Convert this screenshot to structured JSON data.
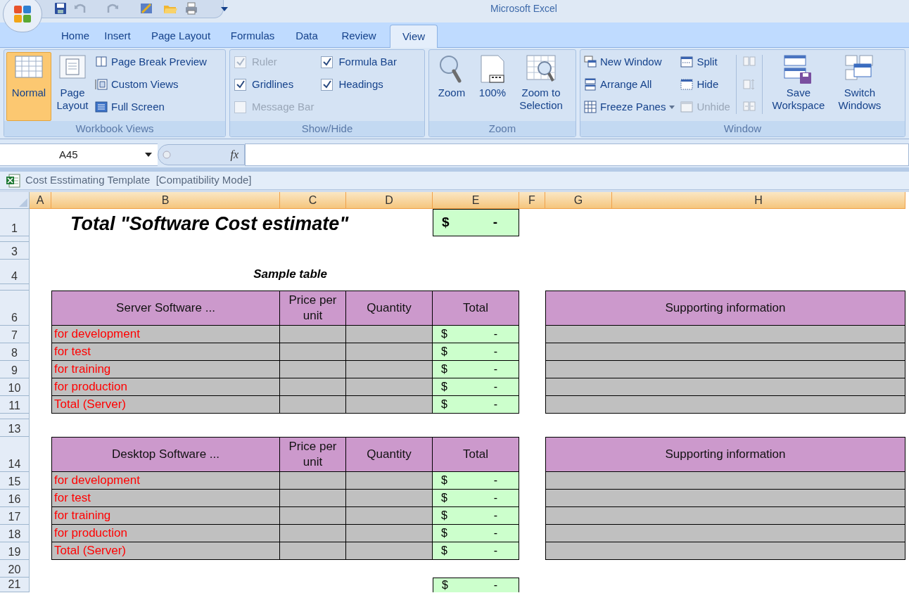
{
  "window": {
    "title": "Microsoft Excel"
  },
  "ribbon_tabs": [
    {
      "label": "Home",
      "selected": false
    },
    {
      "label": "Insert",
      "selected": false
    },
    {
      "label": "Page Layout",
      "selected": false
    },
    {
      "label": "Formulas",
      "selected": false
    },
    {
      "label": "Data",
      "selected": false
    },
    {
      "label": "Review",
      "selected": false
    },
    {
      "label": "View",
      "selected": true
    }
  ],
  "ribbon_groups": [
    {
      "label": "Workbook Views",
      "items": [
        {
          "kind": "large",
          "label": "Normal",
          "selected": true
        },
        {
          "kind": "large",
          "label": "Page Layout",
          "selected": false
        },
        {
          "kind": "small",
          "label": "Page Break Preview",
          "disabled": false
        },
        {
          "kind": "small",
          "label": "Custom Views",
          "disabled": false
        },
        {
          "kind": "small",
          "label": "Full Screen",
          "disabled": false
        }
      ]
    },
    {
      "label": "Show/Hide",
      "items": [
        {
          "kind": "check",
          "label": "Ruler",
          "checked": true,
          "disabled": true
        },
        {
          "kind": "check",
          "label": "Gridlines",
          "checked": true,
          "disabled": false
        },
        {
          "kind": "check",
          "label": "Message Bar",
          "checked": false,
          "disabled": true
        },
        {
          "kind": "check",
          "label": "Formula Bar",
          "checked": true,
          "disabled": false
        },
        {
          "kind": "check",
          "label": "Headings",
          "checked": true,
          "disabled": false
        }
      ]
    },
    {
      "label": "Zoom",
      "items": [
        {
          "kind": "large",
          "label": "Zoom",
          "selected": false
        },
        {
          "kind": "large",
          "label": "100%",
          "selected": false
        },
        {
          "kind": "large",
          "label": "Zoom to Selection",
          "selected": false
        }
      ]
    },
    {
      "label": "Window",
      "items": [
        {
          "kind": "small",
          "label": "New Window",
          "disabled": false
        },
        {
          "kind": "small",
          "label": "Arrange All",
          "disabled": false
        },
        {
          "kind": "menu",
          "label": "Freeze Panes",
          "disabled": false
        },
        {
          "kind": "small",
          "label": "Split",
          "disabled": false
        },
        {
          "kind": "small",
          "label": "Hide",
          "disabled": false
        },
        {
          "kind": "small",
          "label": "Unhide",
          "disabled": true
        },
        {
          "kind": "icon",
          "disabled": true
        },
        {
          "kind": "icon",
          "disabled": true
        },
        {
          "kind": "icon",
          "disabled": true
        },
        {
          "kind": "large",
          "label": "Save Workspace",
          "selected": false
        },
        {
          "kind": "large",
          "label": "Switch Windows",
          "selected": false
        }
      ]
    }
  ],
  "formula_bar": {
    "name_box": "A45",
    "fx_label": "fx"
  },
  "workbook": {
    "title": "Cost Esstimating Template  [Compatibility Mode]"
  },
  "sheet": {
    "columns": [
      "A",
      "B",
      "C",
      "D",
      "E",
      "F",
      "G",
      "H"
    ],
    "row_headers": [
      "1",
      "3",
      "4",
      "6",
      "7",
      "8",
      "9",
      "10",
      "11",
      "13",
      "14",
      "15",
      "16",
      "17",
      "18",
      "19",
      "20",
      "21"
    ],
    "title": "Total \"Software Cost estimate\"",
    "title_total": {
      "currency": "$",
      "amount": "-"
    },
    "caption": "Sample table",
    "tables": [
      {
        "columns": [
          "Server Software ...",
          "Price per unit",
          "Quantity",
          "Total"
        ],
        "side_header": "Supporting information",
        "rows": [
          {
            "item": "for development",
            "currency": "$",
            "amount": "-"
          },
          {
            "item": "for test",
            "currency": "$",
            "amount": "-"
          },
          {
            "item": "for training",
            "currency": "$",
            "amount": "-"
          },
          {
            "item": "for production",
            "currency": "$",
            "amount": "-"
          },
          {
            "item": "Total (Server)",
            "currency": "$",
            "amount": "-"
          }
        ]
      },
      {
        "columns": [
          "Desktop Software ...",
          "Price per unit",
          "Quantity",
          "Total"
        ],
        "side_header": "Supporting information",
        "rows": [
          {
            "item": "for development",
            "currency": "$",
            "amount": "-"
          },
          {
            "item": "for test",
            "currency": "$",
            "amount": "-"
          },
          {
            "item": "for training",
            "currency": "$",
            "amount": "-"
          },
          {
            "item": "for production",
            "currency": "$",
            "amount": "-"
          },
          {
            "item": "Total (Server)",
            "currency": "$",
            "amount": "-"
          }
        ]
      }
    ],
    "grand_total": {
      "currency": "$",
      "amount": "-"
    }
  }
}
